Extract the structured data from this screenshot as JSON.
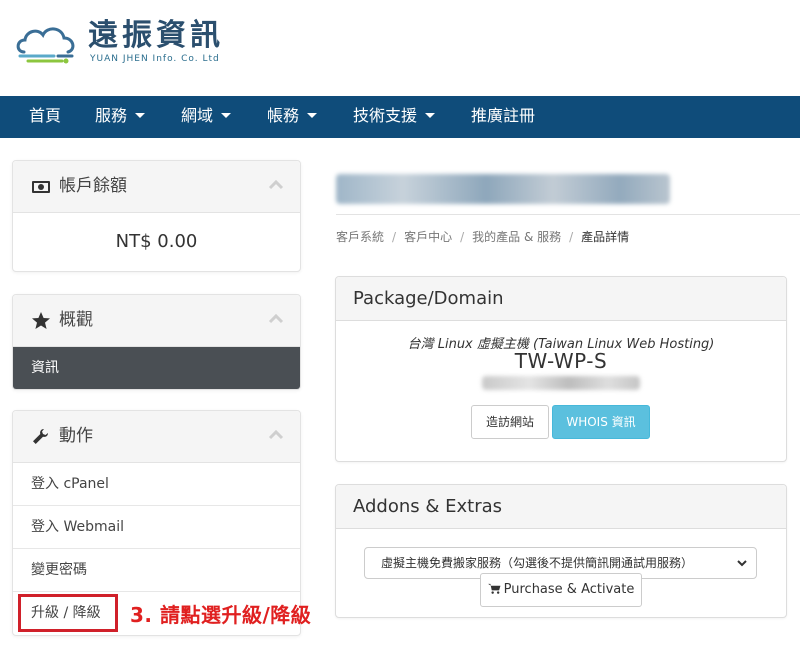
{
  "brand": {
    "title": "遠振資訊",
    "subtitle": "YUAN JHEN Info. Co. Ltd"
  },
  "nav": {
    "items": [
      {
        "label": "首頁",
        "dropdown": false
      },
      {
        "label": "服務",
        "dropdown": true
      },
      {
        "label": "網域",
        "dropdown": true
      },
      {
        "label": "帳務",
        "dropdown": true
      },
      {
        "label": "技術支援",
        "dropdown": true
      },
      {
        "label": "推廣註冊",
        "dropdown": false
      }
    ]
  },
  "sidebar": {
    "balance": {
      "title": "帳戶餘額",
      "icon": "money-icon",
      "amount": "NT$ 0.00"
    },
    "overview": {
      "title": "概觀",
      "icon": "star-icon",
      "active_item": "資訊"
    },
    "actions": {
      "title": "動作",
      "icon": "wrench-icon",
      "items": [
        "登入 cPanel",
        "登入 Webmail",
        "變更密碼",
        "升級 / 降級"
      ]
    }
  },
  "annotation": {
    "text": "3. 請點選升級/降級",
    "color": "#e02020"
  },
  "breadcrumb": {
    "items": [
      "客戶系統",
      "客戶中心",
      "我的產品 & 服務"
    ],
    "current": "產品詳情"
  },
  "package": {
    "header": "Package/Domain",
    "name": "台灣 Linux 虛擬主機 (Taiwan Linux Web Hosting)",
    "code": "TW-WP-S",
    "visit_button": "造訪網站",
    "whois_button": "WHOIS 資訊"
  },
  "addons": {
    "header": "Addons & Extras",
    "select_value": "虛擬主機免費搬家服務（勾選後不提供簡訊開通試用服務）",
    "purchase_button": "Purchase & Activate"
  },
  "colors": {
    "navbar": "#0f4c7a",
    "active_item": "#4a4f54",
    "info_button": "#5bc0de",
    "annotation": "#e02020"
  }
}
